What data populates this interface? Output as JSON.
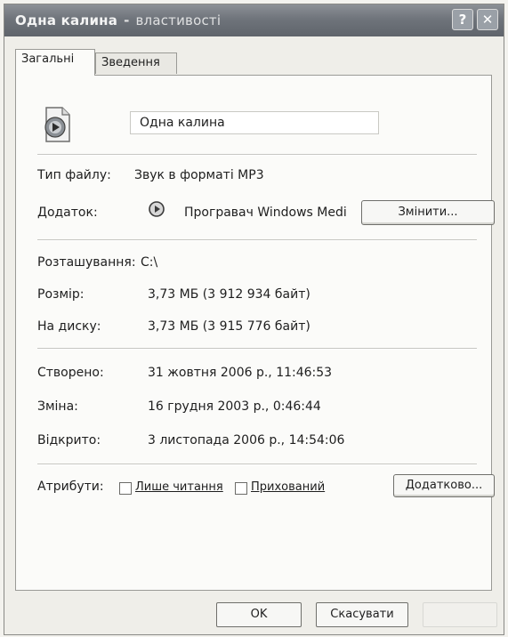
{
  "window": {
    "title": "Одна калина",
    "title_suffix": "властивості",
    "help_glyph": "?",
    "close_glyph": "✕"
  },
  "tabs": [
    {
      "label": "Загальні",
      "active": true
    },
    {
      "label": "Зведення",
      "active": false
    }
  ],
  "file": {
    "icon": "audio-file-icon",
    "name": "Одна калина"
  },
  "type_row": {
    "label": "Тип файлу:",
    "value": "Звук в форматі MP3"
  },
  "app_row": {
    "label": "Додаток:",
    "icon": "media-player-icon",
    "value": "Програвач Windows Medi",
    "button": "Змінити..."
  },
  "location_row": {
    "label": "Розташування:",
    "value": "C:\\"
  },
  "size_row": {
    "label": "Розмір:",
    "value": "3,73 МБ (3 912 934 байт)"
  },
  "disk_row": {
    "label": "На диску:",
    "value": "3,73 МБ (3 915 776 байт)"
  },
  "created_row": {
    "label": "Створено:",
    "value": "31 жовтня 2006 р., 11:46:53"
  },
  "modified_row": {
    "label": "Зміна:",
    "value": "16 грудня 2003 р., 0:46:44"
  },
  "accessed_row": {
    "label": "Відкрито:",
    "value": "3 листопада 2006 р., 14:54:06"
  },
  "attributes": {
    "label": "Атрибути:",
    "readonly_label": "Лише читання",
    "readonly_checked": false,
    "hidden_label": "Прихований",
    "hidden_checked": false,
    "advanced_button": "Додатково..."
  },
  "footer": {
    "ok": "OK",
    "cancel": "Скасувати"
  },
  "colors": {
    "titlebar": "#6f747b",
    "dialog_bg": "#efeee9",
    "panel_bg": "#fbfbf9"
  }
}
